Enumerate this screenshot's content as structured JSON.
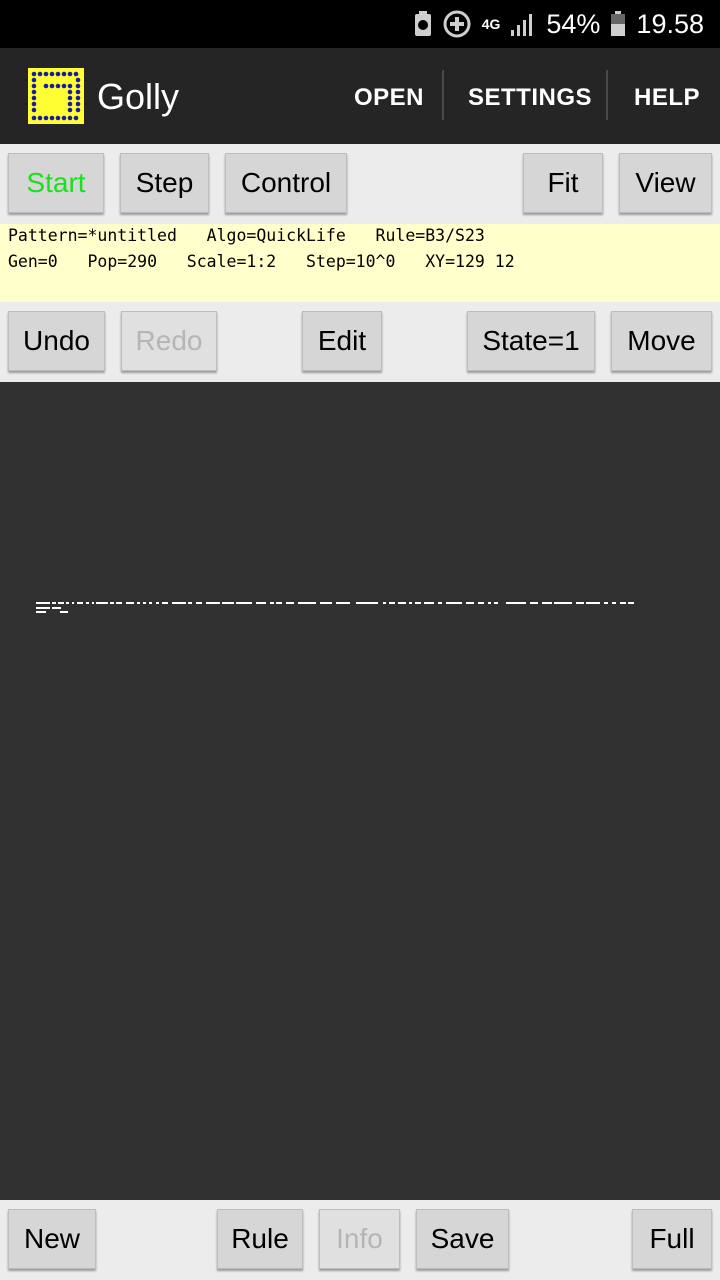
{
  "status_bar": {
    "network": "4G",
    "battery": "54%",
    "time": "19.58"
  },
  "app_bar": {
    "title": "Golly",
    "menu": [
      "OPEN",
      "SETTINGS",
      "HELP"
    ]
  },
  "top_toolbar": {
    "start": "Start",
    "step": "Step",
    "control": "Control",
    "fit": "Fit",
    "view": "View"
  },
  "info": {
    "line1": "Pattern=*untitled   Algo=QuickLife   Rule=B3/S23",
    "line2": "Gen=0   Pop=290   Scale=1:2   Step=10^0   XY=129 12"
  },
  "edit_toolbar": {
    "undo": "Undo",
    "redo": "Redo",
    "edit": "Edit",
    "state": "State=1",
    "move": "Move"
  },
  "bottom_toolbar": {
    "new": "New",
    "rule": "Rule",
    "info": "Info",
    "save": "Save",
    "full": "Full"
  },
  "colors": {
    "start_text": "#1be01b",
    "info_bg": "#ffffcc",
    "canvas_bg": "#313131",
    "logo_bg": "#ffff33",
    "logo_dots": "#1a1aa8"
  }
}
